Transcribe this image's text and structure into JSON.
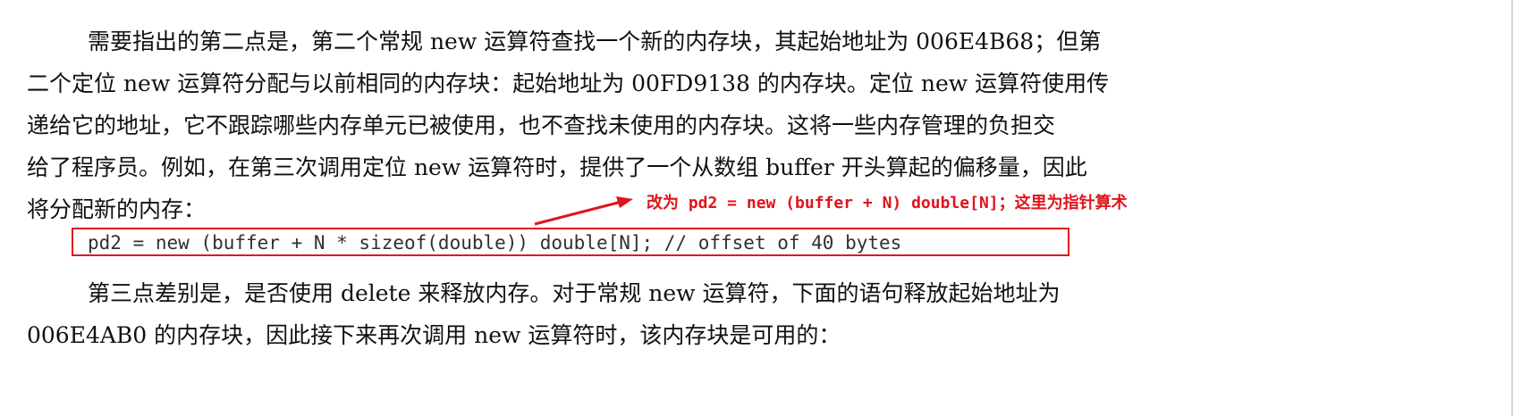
{
  "document": {
    "paragraph_1": {
      "line_1": "需要指出的第二点是，第二个常规 new 运算符查找一个新的内存块，其起始地址为 006E4B68；但第",
      "line_2": "二个定位 new 运算符分配与以前相同的内存块：起始地址为 00FD9138 的内存块。定位 new 运算符使用传",
      "line_3": "递给它的地址，它不跟踪哪些内存单元已被使用，也不查找未使用的内存块。这将一些内存管理的负担交",
      "line_4": "给了程序员。例如，在第三次调用定位 new 运算符时，提供了一个从数组 buffer 开头算起的偏移量，因此",
      "line_5": "将分配新的内存："
    },
    "code_line": "pd2 = new (buffer + N * sizeof(double)) double[N]; // offset of 40 bytes",
    "annotation": "改为 pd2 = new (buffer + N) double[N]；这里为指针算术",
    "paragraph_2": {
      "line_1": "第三点差别是，是否使用 delete 来释放内存。对于常规 new 运算符，下面的语句释放起始地址为",
      "line_2": "006E4AB0 的内存块，因此接下来再次调用 new 运算符时，该内存块是可用的："
    },
    "colors": {
      "annotation_red": "#e0141b",
      "body_text": "#111111",
      "code_text": "#303030"
    }
  }
}
